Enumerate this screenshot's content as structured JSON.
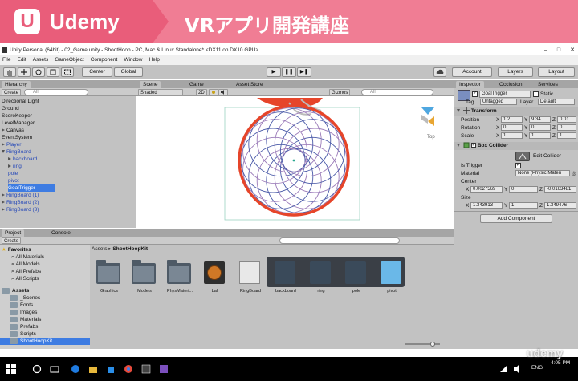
{
  "banner": {
    "brand": "Udemy",
    "logo_letter": "U",
    "course_title": "VRアプリ開発講座",
    "colors": {
      "dark": "#e95d7a",
      "light": "#f07d94"
    }
  },
  "window": {
    "title": "Unity Personal (64bit) - 02_Game.unity - ShootHoop - PC, Mac & Linux Standalone* <DX11 on DX10 GPU>",
    "minimize": "–",
    "maximize": "□",
    "close": "✕"
  },
  "menu": [
    "File",
    "Edit",
    "Assets",
    "GameObject",
    "Component",
    "Window",
    "Help"
  ],
  "toolbar": {
    "pivot": "Center",
    "space": "Global",
    "play": "▶",
    "pause": "❚❚",
    "step": "▶❚",
    "account": "Account",
    "layers": "Layers",
    "layout": "Layout"
  },
  "hierarchy": {
    "tab": "Hierarchy",
    "create": "Create",
    "search_placeholder": "All",
    "items": [
      {
        "label": "Directional Light",
        "depth": 0,
        "kind": "plain"
      },
      {
        "label": "Ground",
        "depth": 0,
        "kind": "plain"
      },
      {
        "label": "ScoreKeeper",
        "depth": 0,
        "kind": "plain"
      },
      {
        "label": "LevelManager",
        "depth": 0,
        "kind": "plain"
      },
      {
        "label": "Canvas",
        "depth": 0,
        "kind": "collapsed"
      },
      {
        "label": "EventSystem",
        "depth": 0,
        "kind": "plain"
      },
      {
        "label": "Player",
        "depth": 0,
        "kind": "collapsed-blue"
      },
      {
        "label": "RingBoard",
        "depth": 0,
        "kind": "expanded-blue"
      },
      {
        "label": "backboard",
        "depth": 1,
        "kind": "collapsed-blue"
      },
      {
        "label": "ring",
        "depth": 1,
        "kind": "collapsed-blue"
      },
      {
        "label": "pole",
        "depth": 1,
        "kind": "blue"
      },
      {
        "label": "pivot",
        "depth": 1,
        "kind": "blue"
      },
      {
        "label": "GoalTrigger",
        "depth": 1,
        "kind": "selected"
      },
      {
        "label": "RingBoard (1)",
        "depth": 0,
        "kind": "collapsed-blue"
      },
      {
        "label": "RingBoard (2)",
        "depth": 0,
        "kind": "collapsed-blue"
      },
      {
        "label": "RingBoard (3)",
        "depth": 0,
        "kind": "collapsed-blue"
      }
    ]
  },
  "scene": {
    "tabs": [
      "Scene",
      "Game",
      "Asset Store"
    ],
    "shading": "Shaded",
    "mode_2d": "2D",
    "gizmos": "Gizmos",
    "search_placeholder": "All",
    "persp": "Top"
  },
  "project": {
    "tabs": [
      "Project",
      "Console"
    ],
    "create": "Create",
    "favorites_label": "Favorites",
    "favorites": [
      "All Materials",
      "All Models",
      "All Prefabs",
      "All Scripts"
    ],
    "assets_label": "Assets",
    "asset_folders": [
      "_Scenes",
      "Fonts",
      "Images",
      "Materials",
      "Prefabs",
      "Scripts",
      "ShootHoopKit"
    ],
    "breadcrumb": {
      "root": "Assets",
      "sep": "▸",
      "current": "ShootHoopKit"
    },
    "grid": [
      "Graphics",
      "Models",
      "PhysMateri...",
      "ball",
      "RingBoard",
      "backboard",
      "ring",
      "pole",
      "pivot"
    ]
  },
  "inspector": {
    "tabs": [
      "Inspector",
      "Occlusion",
      "Services"
    ],
    "object_name": "GoalTrigger",
    "static_label": "Static",
    "tag_label": "Tag",
    "tag_value": "Untagged",
    "layer_label": "Layer",
    "layer_value": "Default",
    "transform": {
      "title": "Transform",
      "position": {
        "label": "Position",
        "x": "1.2",
        "y": "9.34",
        "z": "0.01"
      },
      "rotation": {
        "label": "Rotation",
        "x": "0",
        "y": "0",
        "z": "0"
      },
      "scale": {
        "label": "Scale",
        "x": "1",
        "y": "1",
        "z": "1"
      }
    },
    "box_collider": {
      "title": "Box Collider",
      "edit_collider": "Edit Collider",
      "is_trigger_label": "Is Trigger",
      "material_label": "Material",
      "material_value": "None (Physic Materi",
      "center_label": "Center",
      "center": {
        "x": "0.0027569",
        "y": "0",
        "z": "-0.0163481"
      },
      "size_label": "Size",
      "size": {
        "x": "1.343913",
        "y": "1",
        "z": "1.349476"
      }
    },
    "add_component": "Add Component"
  },
  "watermark": "udemy",
  "taskbar": {
    "lang": "ENG",
    "time": "4:05 PM"
  }
}
